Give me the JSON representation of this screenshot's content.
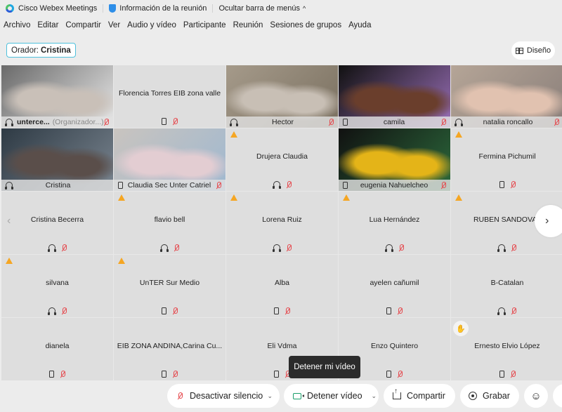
{
  "titlebar": {
    "app_name": "Cisco Webex Meetings",
    "meeting_info": "Información de la reunión",
    "hide_menu": "Ocultar barra de menús",
    "hide_menu_caret": "^"
  },
  "menubar": {
    "items": [
      "Archivo",
      "Editar",
      "Compartir",
      "Ver",
      "Audio y vídeo",
      "Participante",
      "Reunión",
      "Sesiones de grupos",
      "Ayuda"
    ]
  },
  "speaker": {
    "label": "Orador:",
    "name": "Cristina"
  },
  "layout_button": {
    "label": "Diseño"
  },
  "participants": [
    {
      "name": "unterce...",
      "role": "(Organizador...)",
      "video": true,
      "device": "headset-blue",
      "muted": true,
      "warning": false,
      "vid_colors": [
        "#6a6a6a",
        "#c9c0b8",
        "#e8e8e8"
      ]
    },
    {
      "name": "Florencia Torres EIB zona valle",
      "video": false,
      "device": "phone",
      "muted": true,
      "warning": false
    },
    {
      "name": "Hector",
      "video": true,
      "device": "headset",
      "muted": true,
      "warning": false,
      "vid_colors": [
        "#a59a8a",
        "#c8bfb5",
        "#7a7060"
      ]
    },
    {
      "name": "camila",
      "video": true,
      "device": "phone",
      "muted": true,
      "warning": false,
      "vid_colors": [
        "#111",
        "#6a3e2c",
        "#9a6fb8"
      ]
    },
    {
      "name": "natalia roncallo",
      "video": true,
      "device": "headset",
      "muted": true,
      "warning": false,
      "vid_colors": [
        "#b5a597",
        "#e1c2b0",
        "#8a7f7a"
      ]
    },
    {
      "name": "Cristina",
      "video": true,
      "device": "headset",
      "muted": false,
      "warning": false,
      "selected": true,
      "vid_colors": [
        "#2e3a44",
        "#5a4e4a",
        "#7a8590"
      ]
    },
    {
      "name": "Claudia Sec Unter Catriel",
      "video": true,
      "device": "phone",
      "muted": true,
      "warning": false,
      "vid_colors": [
        "#c9c4bf",
        "#e3cdd2",
        "#9fb8d0"
      ]
    },
    {
      "name": "Drujera Claudia",
      "video": false,
      "device": "headset",
      "muted": true,
      "warning": true
    },
    {
      "name": "eugenia Nahuelcheo",
      "video": true,
      "device": "phone",
      "muted": true,
      "warning": false,
      "vid_colors": [
        "#111",
        "#e4b418",
        "#2c6a3c"
      ]
    },
    {
      "name": "Fermina Pichumil",
      "video": false,
      "device": "phone",
      "muted": true,
      "warning": true
    },
    {
      "name": "Cristina Becerra",
      "video": false,
      "device": "headset",
      "muted": true,
      "warning": false
    },
    {
      "name": "flavio bell",
      "video": false,
      "device": "headset",
      "muted": true,
      "warning": true
    },
    {
      "name": "Lorena Ruiz",
      "video": false,
      "device": "headset",
      "muted": true,
      "warning": true
    },
    {
      "name": "Lua Hernández",
      "video": false,
      "device": "headset",
      "muted": true,
      "warning": true
    },
    {
      "name": "RUBEN SANDOVAL",
      "video": false,
      "device": "headset",
      "muted": true,
      "warning": true
    },
    {
      "name": "silvana",
      "video": false,
      "device": "headset",
      "muted": true,
      "warning": true
    },
    {
      "name": "UnTER Sur Medio",
      "video": false,
      "device": "phone",
      "muted": true,
      "warning": true
    },
    {
      "name": "Alba",
      "video": false,
      "device": "phone",
      "muted": true,
      "warning": false
    },
    {
      "name": "ayelen cañumil",
      "video": false,
      "device": "phone",
      "muted": true,
      "warning": false
    },
    {
      "name": "B-Catalan",
      "video": false,
      "device": "headset",
      "muted": true,
      "warning": false
    },
    {
      "name": "dianela",
      "video": false,
      "device": "phone",
      "muted": true,
      "warning": false
    },
    {
      "name": "EIB ZONA ANDINA,Carina Cu...",
      "video": false,
      "device": "phone",
      "muted": true,
      "warning": false
    },
    {
      "name": "Eli Vdma",
      "video": false,
      "device": "phone",
      "muted": true,
      "warning": false
    },
    {
      "name": "Enzo Quintero",
      "video": false,
      "device": "phone",
      "muted": true,
      "warning": false
    },
    {
      "name": "Ernesto Elvio López",
      "video": false,
      "device": "phone",
      "muted": true,
      "warning": false,
      "hand_raised": true
    }
  ],
  "nav": {
    "prev": "‹",
    "next": "›"
  },
  "tooltip": {
    "text": "Detener mi vídeo"
  },
  "toolbar": {
    "unmute_label": "Desactivar silencio",
    "stop_video_label": "Detener vídeo",
    "share_label": "Compartir",
    "record_label": "Grabar",
    "chevron": "⌄",
    "reactions_icon": "☺"
  },
  "colors": {
    "accent": "#1fa7e0",
    "muted_red": "#e5484d",
    "warning": "#f5a623",
    "video_green": "#1a9e6a"
  }
}
